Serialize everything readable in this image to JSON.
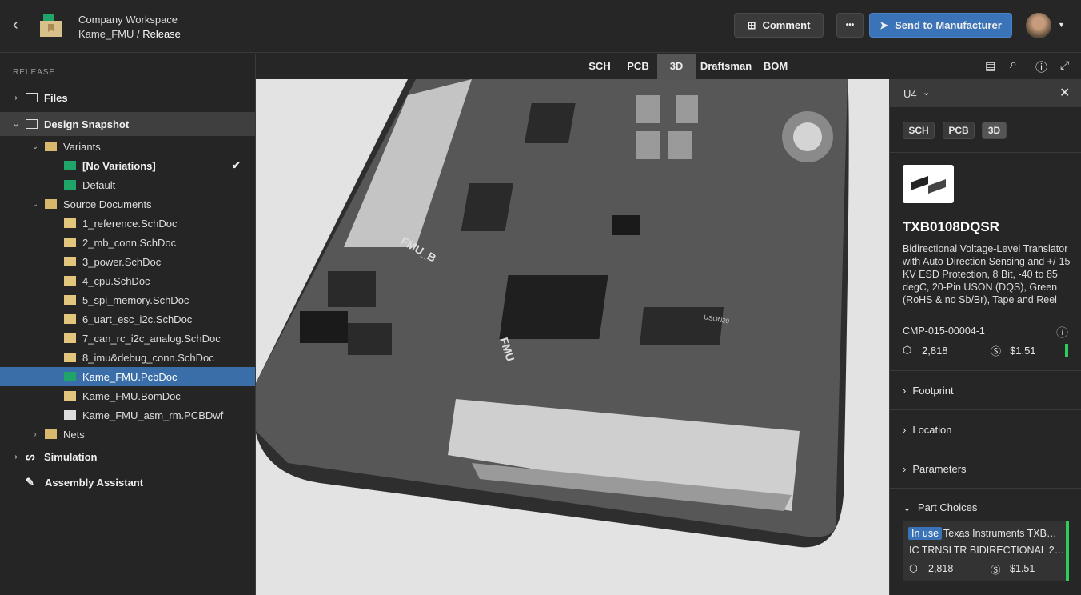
{
  "header": {
    "workspace": "Company Workspace",
    "project": "Kame_FMU",
    "separator": " / ",
    "release": "Release",
    "comment_label": "Comment",
    "more_label": "•••",
    "send_label": "Send to Manufacturer"
  },
  "sidebar": {
    "section": "RELEASE",
    "items": [
      {
        "label": "Files"
      },
      {
        "label": "Design Snapshot"
      },
      {
        "label": "Variants"
      },
      {
        "label": "[No Variations]"
      },
      {
        "label": "Default"
      },
      {
        "label": "Source Documents"
      },
      {
        "label": "1_reference.SchDoc"
      },
      {
        "label": "2_mb_conn.SchDoc"
      },
      {
        "label": "3_power.SchDoc"
      },
      {
        "label": "4_cpu.SchDoc"
      },
      {
        "label": "5_spi_memory.SchDoc"
      },
      {
        "label": "6_uart_esc_i2c.SchDoc"
      },
      {
        "label": "7_can_rc_i2c_analog.SchDoc"
      },
      {
        "label": "8_imu&debug_conn.SchDoc"
      },
      {
        "label": "Kame_FMU.PcbDoc"
      },
      {
        "label": "Kame_FMU.BomDoc"
      },
      {
        "label": "Kame_FMU_asm_rm.PCBDwf"
      },
      {
        "label": "Nets"
      },
      {
        "label": "Simulation"
      },
      {
        "label": "Assembly Assistant"
      }
    ]
  },
  "tabs": [
    "SCH",
    "PCB",
    "3D",
    "Draftsman",
    "BOM"
  ],
  "viewport": {
    "silk_labels": [
      "FMU_B",
      "FMU",
      "USON20"
    ]
  },
  "panel": {
    "designator": "U4",
    "chips": [
      "SCH",
      "PCB",
      "3D"
    ],
    "part": "TXB0108DQSR",
    "description": "Bidirectional Voltage-Level Translator with Auto-Direction Sensing and +/-15 KV ESD Protection, 8 Bit, -40 to 85 degC, 20-Pin USON (DQS), Green (RoHS & no Sb/Br), Tape and Reel",
    "cmp": "CMP-015-00004-1",
    "stock": "2,818",
    "price": "$1.51",
    "sections": [
      "Footprint",
      "Location",
      "Parameters",
      "Part Choices"
    ],
    "choice": {
      "badge": "In use",
      "maker": "Texas Instruments TXB…",
      "desc": "IC TRNSLTR BIDIRECTIONAL 2…",
      "stock": "2,818",
      "price": "$1.51"
    }
  },
  "colors": {
    "accent": "#3a73b8",
    "stock_ok": "#2ecc5a"
  }
}
